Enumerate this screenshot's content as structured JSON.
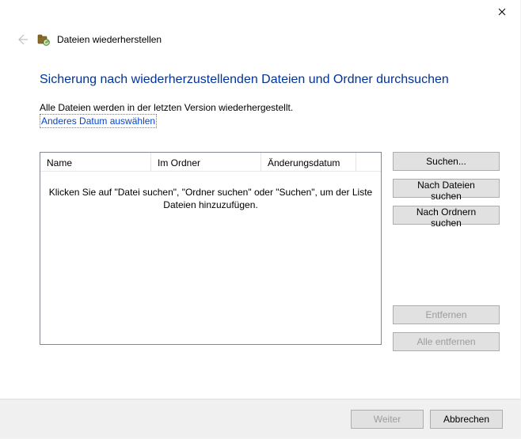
{
  "titlebar": {
    "close_name": "close-icon"
  },
  "header": {
    "back_name": "back-arrow-icon",
    "wizard_icon": "restore-files-icon",
    "wizard_title": "Dateien wiederherstellen"
  },
  "page": {
    "heading": "Sicherung nach wiederherzustellenden Dateien und Ordner durchsuchen",
    "subtext": "Alle Dateien werden in der letzten Version wiederhergestellt.",
    "link": "Anderes Datum auswählen"
  },
  "list": {
    "columns": [
      "Name",
      "Im Ordner",
      "Änderungsdatum"
    ],
    "placeholder": "Klicken Sie auf \"Datei suchen\", \"Ordner suchen\" oder \"Suchen\", um der Liste Dateien hinzuzufügen."
  },
  "buttons": {
    "search": "Suchen...",
    "search_files": "Nach Dateien suchen",
    "search_folders": "Nach Ordnern suchen",
    "remove": "Entfernen",
    "remove_all": "Alle entfernen"
  },
  "footer": {
    "next": "Weiter",
    "cancel": "Abbrechen"
  }
}
